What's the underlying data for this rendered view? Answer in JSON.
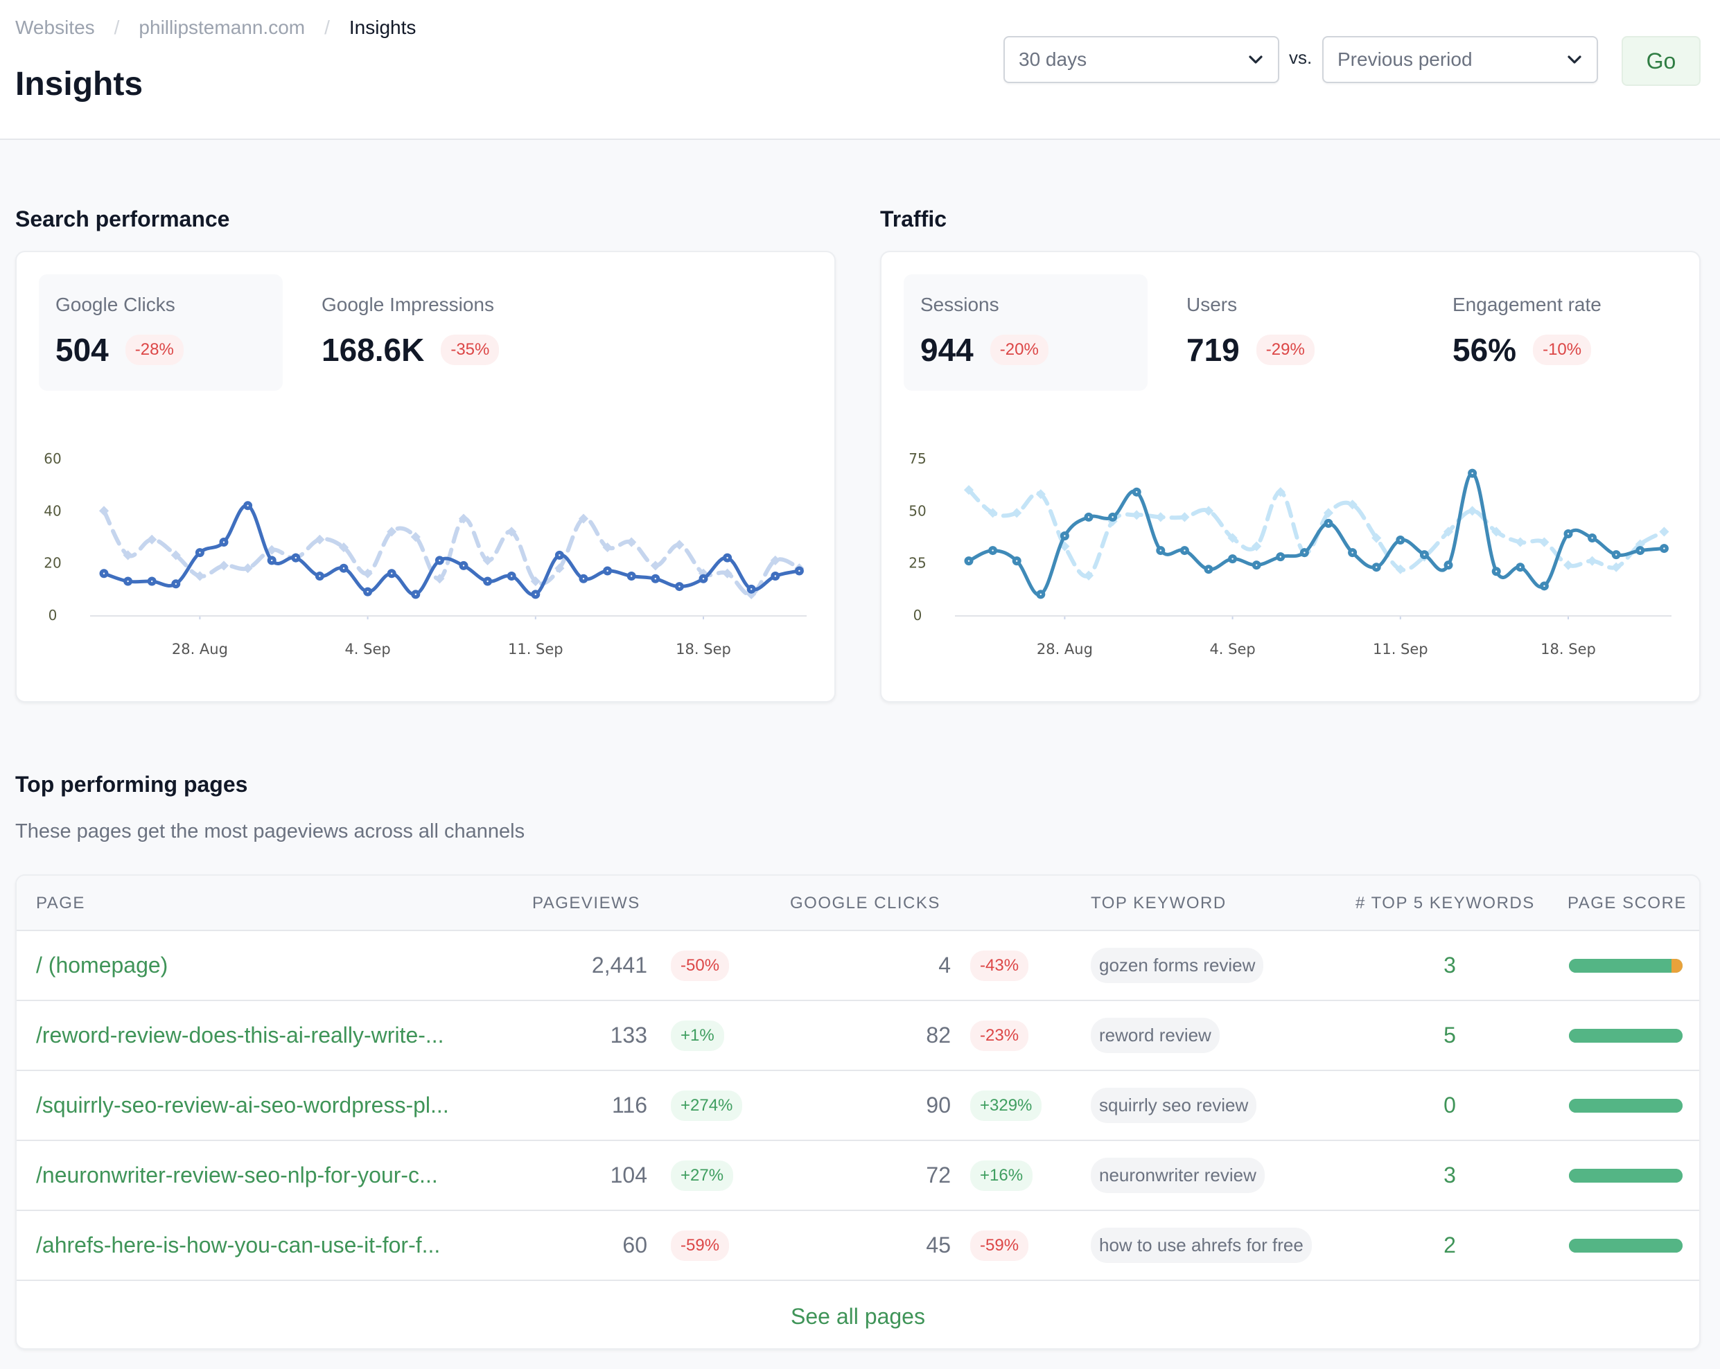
{
  "breadcrumb": [
    "Websites",
    "phillipstemann.com",
    "Insights"
  ],
  "page_title": "Insights",
  "controls": {
    "period": "30 days",
    "vs_label": "vs.",
    "comparison": "Previous period",
    "go_label": "Go"
  },
  "search_performance": {
    "title": "Search performance",
    "metrics": [
      {
        "label": "Google Clicks",
        "value": "504",
        "change": "-28%",
        "trend": "neg",
        "active": true
      },
      {
        "label": "Google Impressions",
        "value": "168.6K",
        "change": "-35%",
        "trend": "neg",
        "active": false
      }
    ]
  },
  "traffic": {
    "title": "Traffic",
    "metrics": [
      {
        "label": "Sessions",
        "value": "944",
        "change": "-20%",
        "trend": "neg",
        "active": true
      },
      {
        "label": "Users",
        "value": "719",
        "change": "-29%",
        "trend": "neg",
        "active": false
      },
      {
        "label": "Engagement rate",
        "value": "56%",
        "change": "-10%",
        "trend": "neg",
        "active": false
      }
    ]
  },
  "chart_data": [
    {
      "type": "line",
      "title": "Google Clicks",
      "x_start": "24 Aug",
      "x_tick_labels": [
        "28. Aug",
        "4. Sep",
        "11. Sep",
        "18. Sep"
      ],
      "x_tick_indices": [
        4,
        11,
        18,
        25
      ],
      "y_ticks": [
        0,
        20,
        40,
        60
      ],
      "ylim": [
        0,
        60
      ],
      "grid": false,
      "colors": {
        "current": "#3f6fbf",
        "previous": "#c5d5ee"
      },
      "series": [
        {
          "name": "Current period",
          "style": "solid",
          "values": [
            16,
            13,
            13,
            12,
            24,
            28,
            42,
            21,
            22,
            15,
            18,
            9,
            16,
            8,
            21,
            19,
            13,
            15,
            8,
            23,
            14,
            17,
            15,
            14,
            11,
            14,
            22,
            10,
            15,
            17
          ]
        },
        {
          "name": "Previous period",
          "style": "dashed",
          "values": [
            40,
            23,
            29,
            23,
            15,
            19,
            18,
            25,
            22,
            29,
            26,
            16,
            32,
            30,
            14,
            37,
            21,
            32,
            13,
            18,
            37,
            26,
            28,
            19,
            27,
            16,
            16,
            8,
            21,
            18
          ]
        }
      ]
    },
    {
      "type": "line",
      "title": "Sessions",
      "x_start": "24 Aug",
      "x_tick_labels": [
        "28. Aug",
        "4. Sep",
        "11. Sep",
        "18. Sep"
      ],
      "x_tick_indices": [
        4,
        11,
        18,
        25
      ],
      "y_ticks": [
        0,
        25,
        50,
        75
      ],
      "ylim": [
        0,
        75
      ],
      "grid": false,
      "colors": {
        "current": "#3f8ab8",
        "previous": "#c4e4f7"
      },
      "series": [
        {
          "name": "Current period",
          "style": "solid",
          "values": [
            26,
            31,
            26,
            10,
            38,
            47,
            47,
            59,
            31,
            31,
            22,
            27,
            24,
            28,
            30,
            44,
            30,
            23,
            36,
            29,
            24,
            68,
            21,
            23,
            14,
            39,
            37,
            29,
            31,
            32
          ]
        },
        {
          "name": "Previous period",
          "style": "dashed",
          "values": [
            60,
            49,
            49,
            58,
            33,
            19,
            45,
            48,
            47,
            47,
            50,
            37,
            33,
            59,
            30,
            49,
            53,
            37,
            22,
            28,
            40,
            50,
            40,
            35,
            35,
            24,
            26,
            23,
            34,
            40
          ]
        }
      ]
    }
  ],
  "top_pages": {
    "title": "Top performing pages",
    "subtitle": "These pages get the most pageviews across all channels",
    "columns": [
      "PAGE",
      "PAGEVIEWS",
      "GOOGLE CLICKS",
      "TOP KEYWORD",
      "# TOP 5 KEYWORDS",
      "PAGE SCORE"
    ],
    "rows": [
      {
        "page": "/ (homepage)",
        "pageviews": "2,441",
        "pv_change": "-50%",
        "pv_trend": "neg",
        "clicks": "4",
        "cl_change": "-43%",
        "cl_trend": "neg",
        "keyword": "gozen forms review",
        "top5": "3",
        "score": 0.9
      },
      {
        "page": "/reword-review-does-this-ai-really-write-...",
        "pageviews": "133",
        "pv_change": "+1%",
        "pv_trend": "pos",
        "clicks": "82",
        "cl_change": "-23%",
        "cl_trend": "neg",
        "keyword": "reword review",
        "top5": "5",
        "score": 1.0
      },
      {
        "page": "/squirrly-seo-review-ai-seo-wordpress-pl...",
        "pageviews": "116",
        "pv_change": "+274%",
        "pv_trend": "pos",
        "clicks": "90",
        "cl_change": "+329%",
        "cl_trend": "pos",
        "keyword": "squirrly seo review",
        "top5": "0",
        "score": 1.0
      },
      {
        "page": "/neuronwriter-review-seo-nlp-for-your-c...",
        "pageviews": "104",
        "pv_change": "+27%",
        "pv_trend": "pos",
        "clicks": "72",
        "cl_change": "+16%",
        "cl_trend": "pos",
        "keyword": "neuronwriter review",
        "top5": "3",
        "score": 1.0
      },
      {
        "page": "/ahrefs-here-is-how-you-can-use-it-for-f...",
        "pageviews": "60",
        "pv_change": "-59%",
        "pv_trend": "neg",
        "clicks": "45",
        "cl_change": "-59%",
        "cl_trend": "neg",
        "keyword": "how to use ahrefs for free",
        "top5": "2",
        "score": 1.0
      }
    ],
    "see_all_label": "See all pages"
  }
}
